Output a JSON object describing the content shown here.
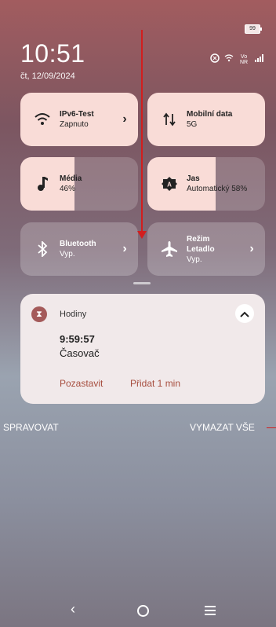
{
  "status": {
    "battery": "99",
    "clock": "10:51",
    "date": "čt, 12/09/2024",
    "icons": [
      "nfc-icon",
      "wifi-icon",
      "volte-icon",
      "signal-icon"
    ],
    "network_small": "Vo NR"
  },
  "tiles": {
    "wifi": {
      "title": "IPv6-Test",
      "status": "Zapnuto"
    },
    "mobile_data": {
      "title": "Mobilní data",
      "status": "5G"
    },
    "media": {
      "title": "Média",
      "value": "46%",
      "level": 0.46
    },
    "brightness": {
      "title": "Jas",
      "value": "Automatický 58%",
      "level": 0.58
    },
    "bluetooth": {
      "title": "Bluetooth",
      "status": "Vyp."
    },
    "airplane": {
      "title_line1": "Režim",
      "title_line2": "Letadlo",
      "status": "Vyp."
    }
  },
  "notification": {
    "app_name": "Hodiny",
    "time": "9:59:57",
    "label": "Časovač",
    "action_pause": "Pozastavit",
    "action_add": "Přidat 1 min"
  },
  "footer": {
    "manage": "SPRAVOVAT",
    "clear_all": "VYMAZAT VŠE"
  },
  "colors": {
    "tile_active": "#f9dcd7",
    "accent_action": "#a74e3f",
    "annotation_red": "#d21e1e"
  }
}
